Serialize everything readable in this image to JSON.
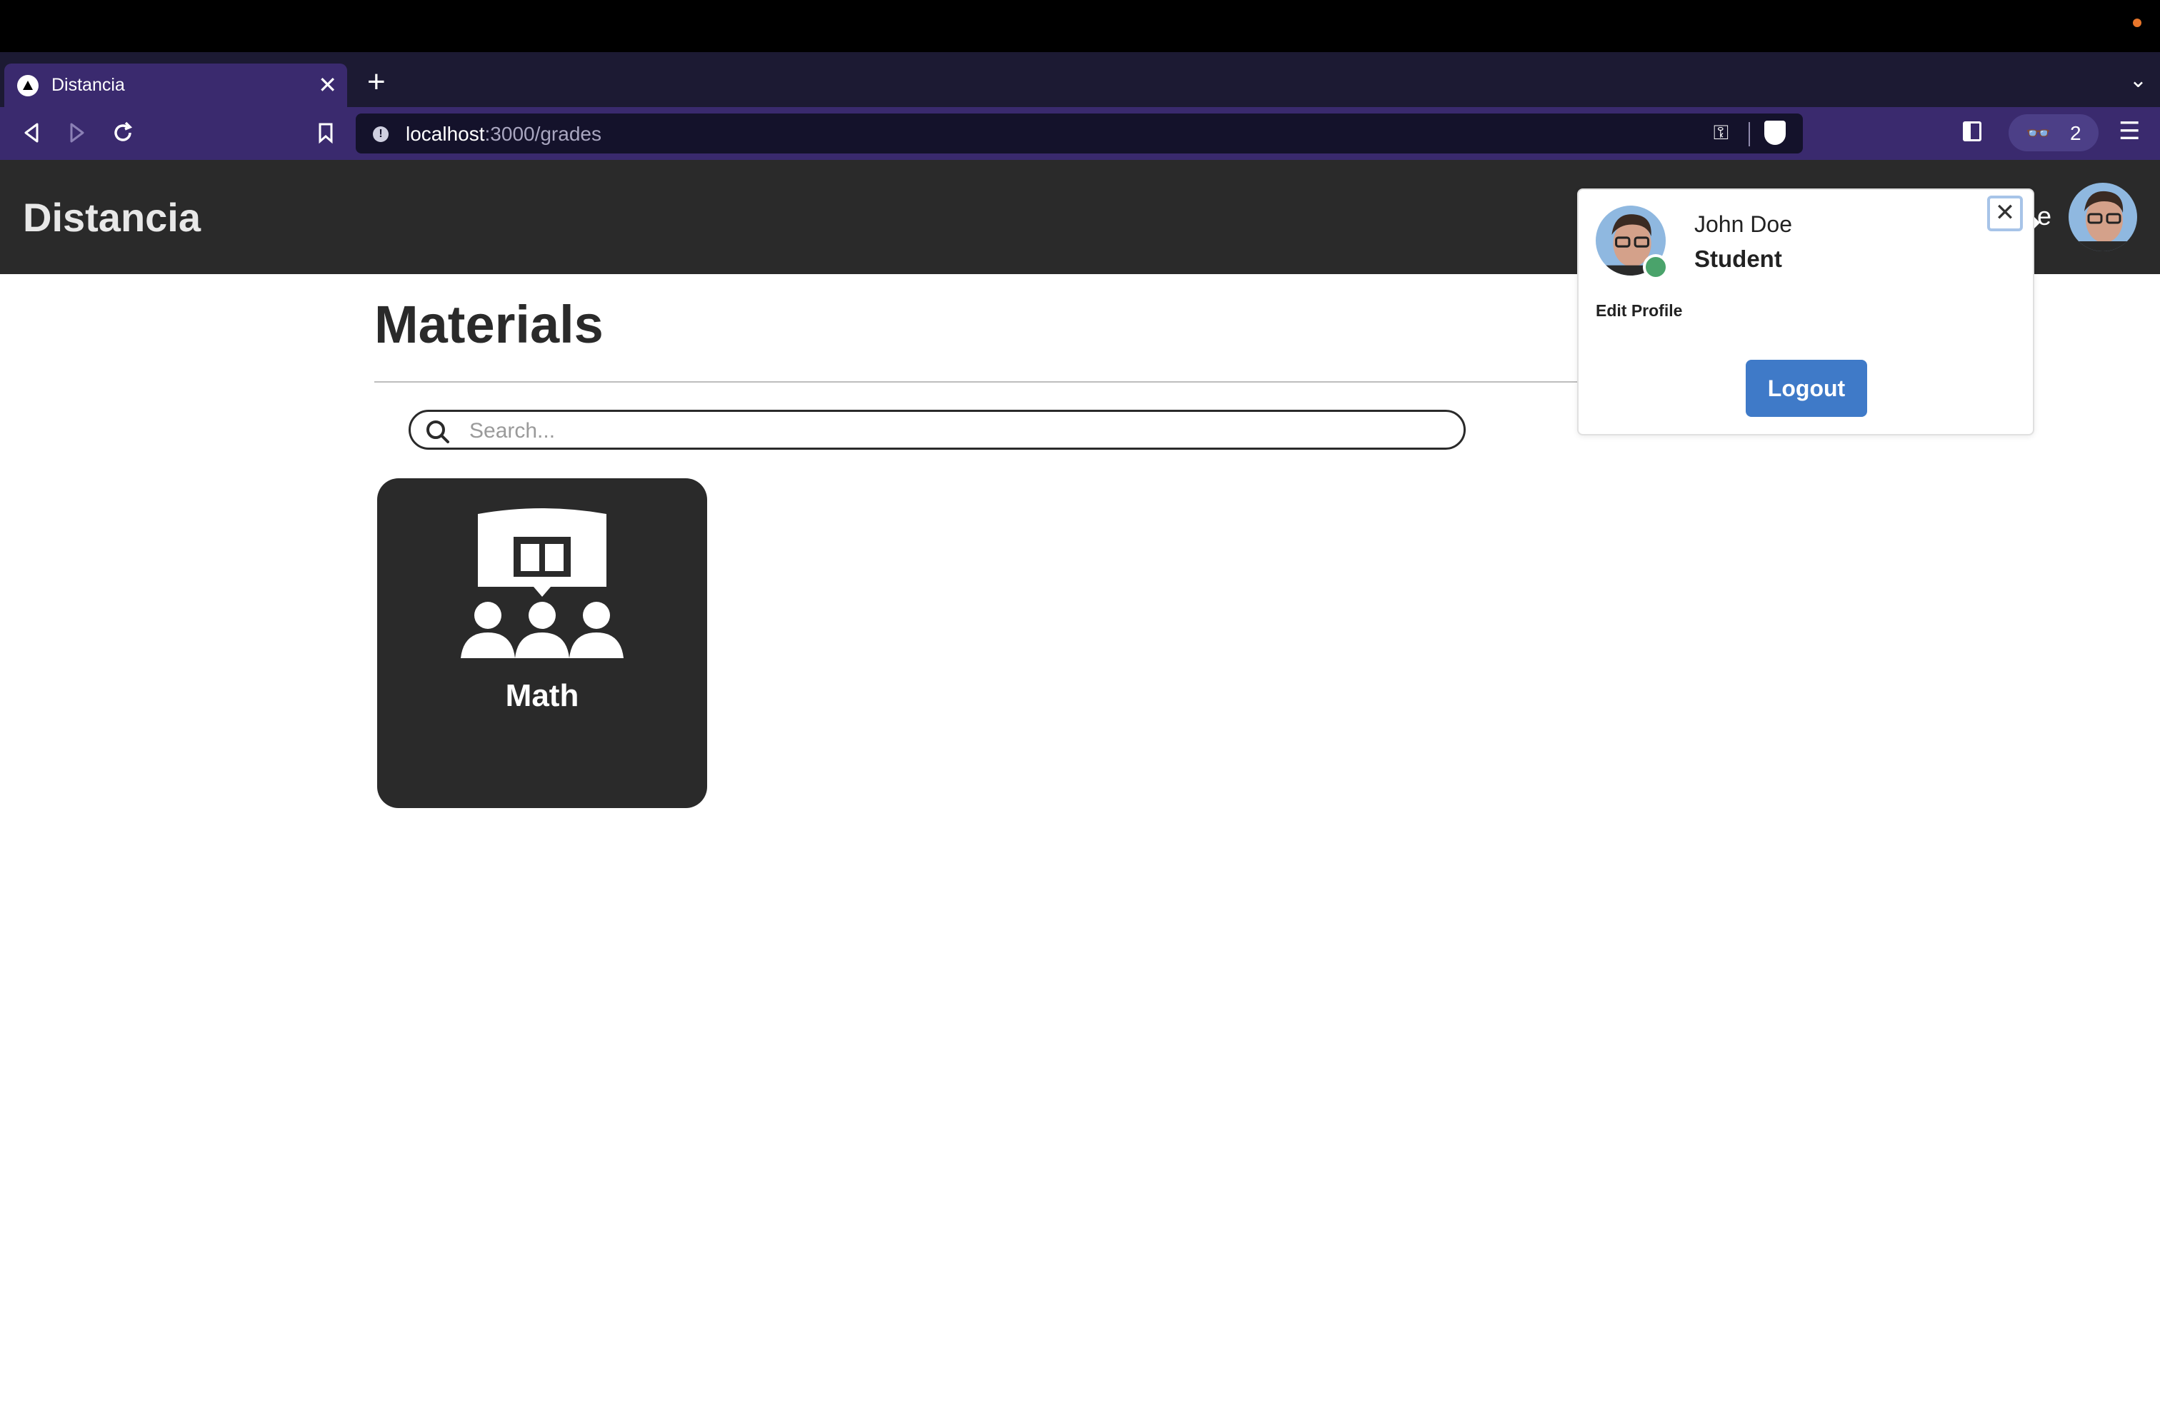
{
  "browser": {
    "tab_title": "Distancia",
    "tab_close": "✕",
    "new_tab": "+",
    "url_host": "localhost",
    "url_path": ":3000/grades",
    "shields_count": "2"
  },
  "app": {
    "brand": "Distancia",
    "header_partial_text": "e"
  },
  "main": {
    "page_title": "Materials",
    "search": {
      "placeholder": "Search..."
    },
    "cards": [
      {
        "label": "Math",
        "icon": "classroom-book-icon"
      }
    ]
  },
  "profile_popover": {
    "name": "John Doe",
    "role": "Student",
    "edit_label": "Edit Profile",
    "logout_label": "Logout",
    "close": "✕",
    "status": "online"
  },
  "colors": {
    "header_bg": "#2a2a2a",
    "card_bg": "#2a2a2a",
    "logout_bg": "#3f7ac8",
    "status_online": "#4aa36b",
    "browser_toolbar": "#3a2a6e"
  }
}
